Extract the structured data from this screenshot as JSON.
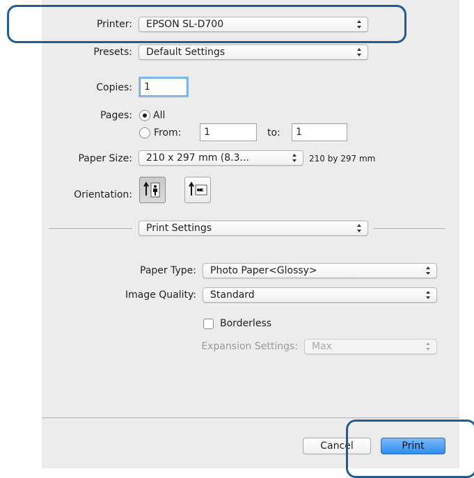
{
  "printer": {
    "label": "Printer:",
    "value": "EPSON SL-D700"
  },
  "presets": {
    "label": "Presets:",
    "value": "Default Settings"
  },
  "copies": {
    "label": "Copies:",
    "value": "1"
  },
  "pages": {
    "label": "Pages:",
    "all_label": "All",
    "from_label": "From:",
    "from_value": "1",
    "to_label": "to:",
    "to_value": "1",
    "selected": "All"
  },
  "paper_size": {
    "label": "Paper Size:",
    "value": "210 x 297 mm (8.3...",
    "hint": "210 by 297 mm"
  },
  "orientation": {
    "label": "Orientation:",
    "selected": "portrait"
  },
  "section": {
    "value": "Print Settings"
  },
  "paper_type": {
    "label": "Paper Type:",
    "value": "Photo Paper<Glossy>"
  },
  "image_quality": {
    "label": "Image Quality:",
    "value": "Standard"
  },
  "borderless": {
    "label": "Borderless",
    "checked": false
  },
  "expansion": {
    "label": "Expansion Settings:",
    "value": "Max",
    "enabled": false
  },
  "buttons": {
    "cancel": "Cancel",
    "print": "Print"
  },
  "colors": {
    "callout": "#1e5c93",
    "focus": "#5b9ce6",
    "default_button": "#2c8ff0"
  },
  "icons": [
    "up-down-arrows-icon",
    "portrait-orientation-icon",
    "landscape-orientation-icon"
  ]
}
